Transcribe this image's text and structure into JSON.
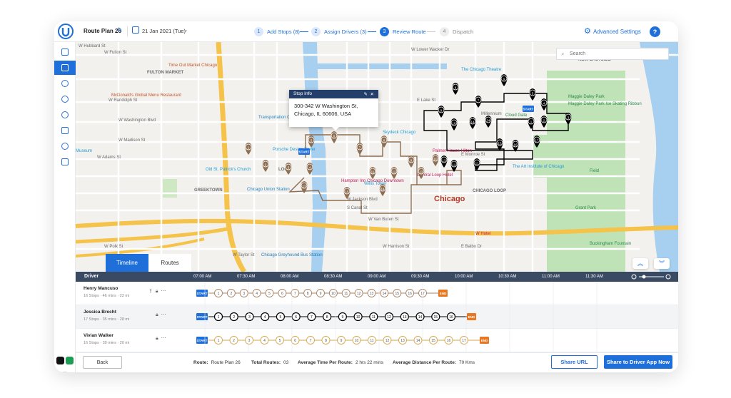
{
  "header": {
    "plan_name": "Route Plan 26",
    "date": "21 Jan 2021 (Tue)",
    "steps": [
      {
        "num": "1",
        "label": "Add Stops (8)",
        "state": "done"
      },
      {
        "num": "2",
        "label": "Assign Drivers (3)",
        "state": "done"
      },
      {
        "num": "3",
        "label": "Review Route",
        "state": "active"
      },
      {
        "num": "4",
        "label": "Dispatch",
        "state": "pending"
      }
    ],
    "advanced_settings": "Advanced Settings",
    "help": "?"
  },
  "sidebar": {
    "icons": [
      "home-icon",
      "routes-icon",
      "users-icon",
      "history-icon",
      "location-icon",
      "contacts-icon",
      "help-circle-icon",
      "chat-icon"
    ],
    "active_index": 1,
    "avatar_label": "Vivian Walker"
  },
  "map": {
    "search_placeholder": "Search",
    "popup": {
      "title": "Stop Info",
      "address_line1": "300-342 W Washington St,",
      "address_line2": "Chicago, IL 60606, USA"
    },
    "city_label": "Chicago",
    "labels": [
      {
        "t": "W Hubbard St"
      },
      {
        "t": "W Fulton St"
      },
      {
        "t": "FULTON MARKET"
      },
      {
        "t": "W Randolph St"
      },
      {
        "t": "W Washington Blvd"
      },
      {
        "t": "W Madison St"
      },
      {
        "t": "W Adams St"
      },
      {
        "t": "W Jackson Blvd"
      },
      {
        "t": "W Van Buren St"
      },
      {
        "t": "W Harrison St"
      },
      {
        "t": "W Polk St"
      },
      {
        "t": "W Taylor St"
      },
      {
        "t": "GREEKTOWN"
      },
      {
        "t": "LOOP"
      },
      {
        "t": "CHICAGO LOOP"
      },
      {
        "t": "NEW EASTSIDE"
      },
      {
        "t": "E Lake St"
      },
      {
        "t": "E Monroe St"
      },
      {
        "t": "E Balbo Dr"
      },
      {
        "t": "S Canal St"
      },
      {
        "t": "W Lower Wacker Dr"
      },
      {
        "t": "Chicago Union Station"
      },
      {
        "t": "Chicago Greyhound Bus Station"
      },
      {
        "t": "Transportation Center"
      },
      {
        "t": "Millennium"
      },
      {
        "t": "Grant Park"
      }
    ],
    "pois": [
      {
        "t": "Time Out Market Chicago",
        "color": "#c0562b"
      },
      {
        "t": "McDonald's Global Menu Restaurant",
        "color": "#c0562b"
      },
      {
        "t": "The Chicago Theatre",
        "color": "#1e9bd7"
      },
      {
        "t": "Maggie Daley Park",
        "color": "#2c8a4b"
      },
      {
        "t": "Maggie Daley Park Ice Skating Ribbon",
        "color": "#2c8a4b"
      },
      {
        "t": "The Art Institute of Chicago",
        "color": "#1e9bd7"
      },
      {
        "t": "Palmer House Hilton",
        "color": "#c2185b"
      },
      {
        "t": "Central Loop Hotel",
        "color": "#c2185b"
      },
      {
        "t": "Hampton Inn Chicago Downtown",
        "color": "#c2185b"
      },
      {
        "t": "Willis Tower",
        "color": "#1e9bd7"
      },
      {
        "t": "Old St. Patrick's Church",
        "color": "#1e9bd7"
      },
      {
        "t": "Skydeck Chicago",
        "color": "#1e9bd7"
      },
      {
        "t": "Cloud Gate",
        "color": "#2c8a4b"
      },
      {
        "t": "Buckingham Fountain",
        "color": "#2c8a4b"
      },
      {
        "t": "Museum",
        "color": "#1e9bd7"
      },
      {
        "t": "W Hotel",
        "color": "#c2185b"
      },
      {
        "t": "Porsche Design Tower",
        "color": "#1e9bd7"
      },
      {
        "t": "Field",
        "color": "#2c8a4b"
      }
    ],
    "tabs": [
      {
        "label": "Timeline",
        "active": true
      },
      {
        "label": "Routes",
        "active": false
      }
    ],
    "colors": {
      "route_black": "#000000",
      "route_brown": "#8d6e52",
      "route_tan": "#d6a84b",
      "start": "#1e6fd9",
      "end": "#e87722"
    }
  },
  "timeline": {
    "driver_header": "Driver",
    "times": [
      "07:00 AM",
      "07:30 AM",
      "08:00 AM",
      "08:30 AM",
      "09:00 AM",
      "09:30 AM",
      "10:00 AM",
      "10:30 AM",
      "11:00 AM",
      "11:30 AM"
    ],
    "start_label": "START",
    "end_label": "END",
    "drivers": [
      {
        "name": "Henry Mancuso",
        "stops": "16 Stops",
        "duration": "46 mins",
        "distance": "22 mi",
        "color": "#a98263",
        "selected": false,
        "stop_labels": [
          "1",
          "2",
          "3",
          "4",
          "5",
          "6",
          "7",
          "8",
          "9",
          "10",
          "11",
          "12",
          "13",
          "14",
          "15",
          "16",
          "17"
        ]
      },
      {
        "name": "Jessica Brecht",
        "stops": "17 Stops",
        "duration": "35 mins",
        "distance": "28 mi",
        "color": "#000000",
        "selected": true,
        "stop_labels": [
          "1",
          "2",
          "3",
          "4",
          "5",
          "6",
          "7",
          "8",
          "9",
          "10",
          "11",
          "12",
          "13",
          "14",
          "15",
          "16"
        ]
      },
      {
        "name": "Vivian Walker",
        "stops": "16 Stops",
        "duration": "39 mins",
        "distance": "20 mi",
        "color": "#d6a84b",
        "selected": false,
        "stop_labels": [
          "1",
          "2",
          "3",
          "4",
          "5",
          "6",
          "7",
          "8",
          "9",
          "10",
          "11",
          "12",
          "13",
          "14",
          "15",
          "16",
          "17"
        ]
      }
    ]
  },
  "footer": {
    "back": "Back",
    "route_label": "Route:",
    "route_value": "Route Plan 26",
    "total_routes_label": "Total Routes:",
    "total_routes_value": "03",
    "avg_time_label": "Average Time Per Route:",
    "avg_time_value": "2 hrs 22 mins",
    "avg_dist_label": "Average Distance Per Route:",
    "avg_dist_value": "70 Kms",
    "share_url": "Share URL",
    "share_app": "Share to Driver App Now"
  }
}
